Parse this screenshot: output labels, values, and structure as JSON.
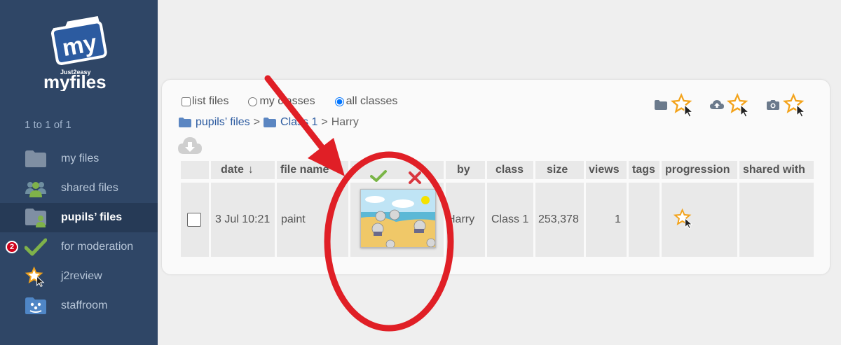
{
  "sidebar": {
    "logo": {
      "word_my": "my",
      "tagline": "Just2easy",
      "word_myfiles": "myfiles"
    },
    "range_text": "1 to 1 of 1",
    "items": [
      {
        "label": "my files",
        "icon": "folder-icon"
      },
      {
        "label": "shared files",
        "icon": "people-icon"
      },
      {
        "label": "pupils’ files",
        "icon": "pupil-folder-icon",
        "active": true
      },
      {
        "label": "for moderation",
        "icon": "checkmark-icon",
        "badge": "2"
      },
      {
        "label": "j2review",
        "icon": "star-cursor-icon"
      },
      {
        "label": "staffroom",
        "icon": "staffroom-folder-icon"
      }
    ]
  },
  "options": {
    "list_files": "list files",
    "my_classes": "my classes",
    "all_classes": "all classes",
    "selected": "all classes"
  },
  "toolbar": {
    "icons": [
      "folder-icon",
      "star-cursor-icon",
      "cloud-upload-icon",
      "star-cursor-icon",
      "camera-icon",
      "star-cursor-icon"
    ]
  },
  "breadcrumb": {
    "items": [
      "pupils’ files",
      "Class 1"
    ],
    "separator": ">",
    "current": "Harry"
  },
  "table": {
    "columns": [
      "date",
      "file name",
      "",
      "by",
      "class",
      "size",
      "views",
      "tags",
      "progression",
      "shared with"
    ],
    "sort_indicator": "↓",
    "rows": [
      {
        "date": "3 Jul 10:21",
        "file_name": "paint",
        "by": "Harry",
        "class": "Class 1",
        "size": "253,378",
        "views": "1",
        "tags": "",
        "progression": "star-cursor-icon",
        "shared_with": ""
      }
    ]
  },
  "colors": {
    "sidebar_bg": "#2f4666",
    "sidebar_active": "#263a56",
    "link_blue": "#2c5ba0",
    "annotation_red": "#e01f26",
    "approve_green": "#7ab547",
    "reject_red": "#d9373f",
    "star_orange": "#f3a31b"
  }
}
